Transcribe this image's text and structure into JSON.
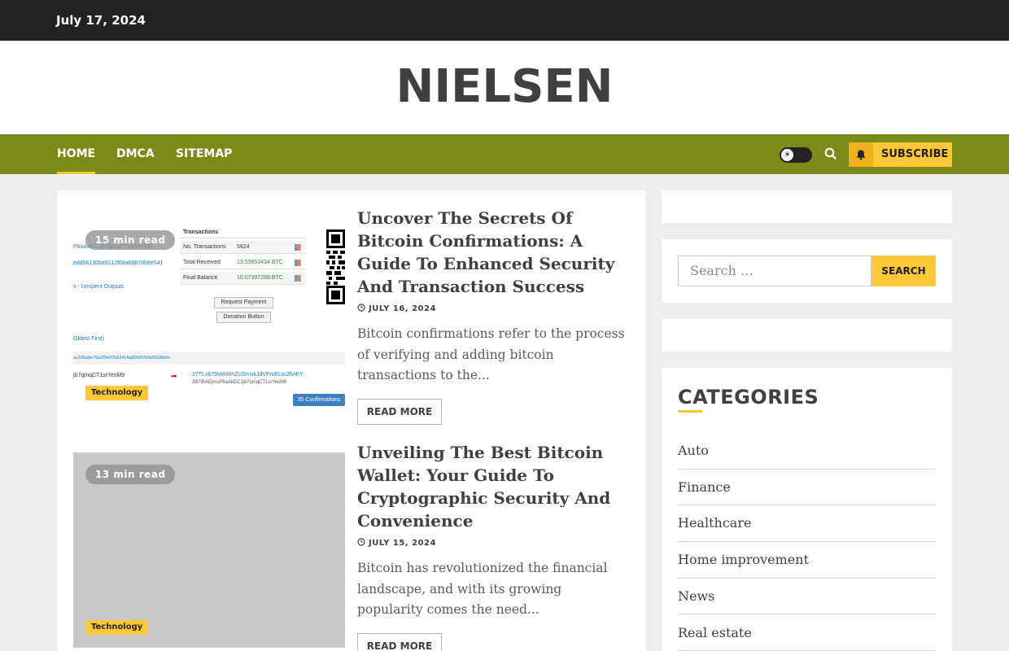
{
  "topbar": {
    "date": "July 17, 2024"
  },
  "site": {
    "title": "NIELSEN"
  },
  "nav": {
    "items": [
      {
        "label": "Home",
        "active": true
      },
      {
        "label": "DMCA",
        "active": false
      },
      {
        "label": "Sitemap",
        "active": false
      }
    ],
    "subscribe_label": "Subscribe",
    "icons": [
      "theme-toggle-icon",
      "search-icon",
      "bell-icon"
    ]
  },
  "posts": [
    {
      "read_time": "15 min read",
      "category": "Technology",
      "title": "Uncover The Secrets Of Bitcoin Confirmations: A Guide To Enhanced Security And Transaction Success",
      "date": "July 16, 2024",
      "excerpt": "Bitcoin confirmations refer to the process of verifying and adding bitcoin transactions to the...",
      "read_more": "Read More",
      "thumb": {
        "header": "Transactions",
        "rows": [
          {
            "label": "No. Transactions",
            "value": "5924"
          },
          {
            "label": "Total Received",
            "value": "13.55853434 BTC"
          },
          {
            "label": "Final Balance",
            "value": "10.07397289 BTC"
          }
        ],
        "address_lines": [
          "P6aAkECJjb7qmqCT1srYesM9",
          "edd56130ba9112f68a6d87db8e541",
          "s - Unspent Outputs"
        ],
        "buttons": [
          "Request Payment",
          "Donation Button"
        ],
        "oldest": "Oldest First)",
        "hash": "ac195a9e75a25fe97bb3414a8260f7b5d5938b0e",
        "from": "jb7qmqCT1srYesM9",
        "to1": "37TLx679xM46hZUSmvkJdVFrvELm2fV4IY",
        "to2": "3B7iBAEjmsP6aAkECJjb7qmqCT1srYesM9",
        "confirmations": "35 Confirmations"
      }
    },
    {
      "read_time": "13 min read",
      "category": "Technology",
      "title": "Unveiling The Best Bitcoin Wallet: Your Guide To Cryptographic Security And Convenience",
      "date": "July 15, 2024",
      "excerpt": "Bitcoin has revolutionized the financial landscape, and with its growing popularity comes the need...",
      "read_more": "Read More"
    }
  ],
  "sidebar": {
    "search": {
      "placeholder": "Search …",
      "button": "Search"
    },
    "categories": {
      "heading": "Categories",
      "items": [
        "Auto",
        "Finance",
        "Healthcare",
        "Home improvement",
        "News",
        "Real estate"
      ]
    }
  },
  "colors": {
    "accent": "#fcc83a",
    "nav_bg": "#7a8b18",
    "topbar_bg": "#222222"
  }
}
